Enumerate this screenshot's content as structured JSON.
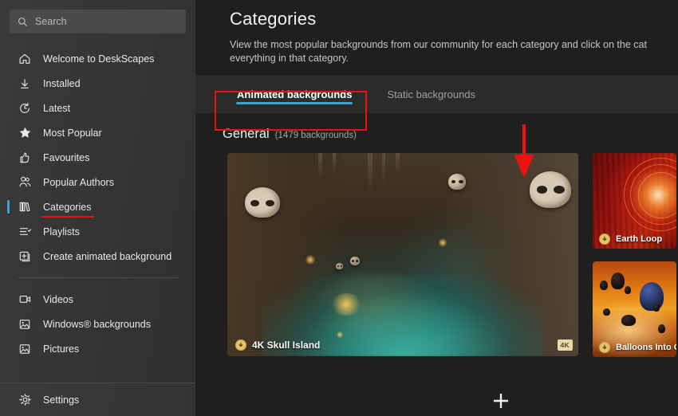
{
  "sidebar": {
    "search": {
      "placeholder": "Search",
      "icon": "search-icon",
      "value": ""
    },
    "items": [
      {
        "label": "Welcome to DeskScapes",
        "icon": "home-icon"
      },
      {
        "label": "Installed",
        "icon": "download-icon"
      },
      {
        "label": "Latest",
        "icon": "clock-icon"
      },
      {
        "label": "Most Popular",
        "icon": "star-icon"
      },
      {
        "label": "Favourites",
        "icon": "thumbs-up-icon"
      },
      {
        "label": "Popular Authors",
        "icon": "people-icon"
      },
      {
        "label": "Categories",
        "icon": "books-icon"
      },
      {
        "label": "Playlists",
        "icon": "playlist-icon"
      },
      {
        "label": "Create animated background",
        "icon": "plus-square-icon"
      }
    ],
    "items2": [
      {
        "label": "Videos",
        "icon": "video-icon"
      },
      {
        "label": "Windows® backgrounds",
        "icon": "picture-icon"
      },
      {
        "label": "Pictures",
        "icon": "picture-icon"
      }
    ],
    "settings": {
      "label": "Settings",
      "icon": "gear-icon"
    },
    "selected": "Categories",
    "selected_indicator_color": "#3aa6cf",
    "annotation_underline_color": "#ee1111"
  },
  "main": {
    "title": "Categories",
    "description": "View the most popular backgrounds from our community for each category and click on the cat\neverything in that category.",
    "tabs": [
      {
        "label": "Animated backgrounds",
        "active": true
      },
      {
        "label": "Static backgrounds",
        "active": false
      }
    ],
    "tab_underline_color": "#3aa6cf",
    "section": {
      "title": "General",
      "count": "(1479 backgrounds)"
    },
    "cards": [
      {
        "label": "4K Skull Island",
        "badge": "4K",
        "download_icon": "download-circle-icon",
        "size": "big"
      },
      {
        "label": "Earth Loop",
        "download_icon": "download-circle-icon",
        "size": "small"
      },
      {
        "label": "Balloons Into G",
        "download_icon": "download-circle-icon",
        "size": "small"
      }
    ]
  },
  "annotations": {
    "arrow_color": "#ee1111",
    "box_color": "#ee1111",
    "cursor": "plus-cursor"
  }
}
